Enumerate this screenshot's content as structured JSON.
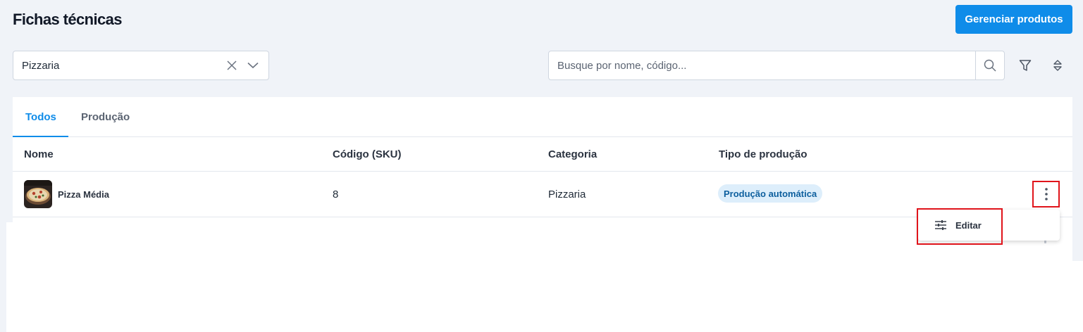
{
  "header": {
    "title": "Fichas técnicas",
    "manage_button": "Gerenciar produtos"
  },
  "filters": {
    "category_select": {
      "value": "Pizzaria"
    },
    "search": {
      "placeholder": "Busque por nome, código..."
    }
  },
  "tabs": [
    {
      "label": "Todos",
      "active": true
    },
    {
      "label": "Produção",
      "active": false
    }
  ],
  "table": {
    "columns": [
      "Nome",
      "Código (SKU)",
      "Categoria",
      "Tipo de produção"
    ],
    "rows": [
      {
        "name": "Pizza Média",
        "sku": "8",
        "category": "Pizzaria",
        "production_type": "Produção automática"
      }
    ]
  },
  "row_menu": {
    "items": [
      {
        "label": "Editar",
        "icon": "sliders-icon"
      }
    ]
  },
  "colors": {
    "primary": "#0f8ce9",
    "badge_bg": "#ddeefb",
    "badge_text": "#0d5f9e",
    "highlight": "#e0141b"
  }
}
